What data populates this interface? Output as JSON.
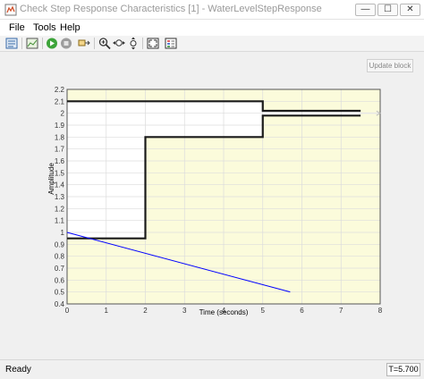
{
  "window": {
    "title": "Check Step Response Characteristics [1] - WaterLevelStepResponse",
    "minimize_glyph": "—",
    "maximize_glyph": "☐",
    "close_glyph": "✕"
  },
  "menu": {
    "items": [
      "File",
      "Tools",
      "Help"
    ]
  },
  "toolbar": {
    "buttons": [
      "block-parameters",
      "save-figure",
      "run-simulation",
      "stop-simulation",
      "highlight-block",
      "zoom-in",
      "zoom-x",
      "zoom-y",
      "fit-to-view",
      "legend"
    ]
  },
  "update_block": {
    "label": "Update block"
  },
  "status": {
    "text": "Ready",
    "time": "T=5.700"
  },
  "chart_data": {
    "type": "line",
    "xlabel": "Time (seconds)",
    "ylabel": "Amplitude",
    "xlim": [
      0,
      8
    ],
    "ylim": [
      0.4,
      2.2
    ],
    "xticks": [
      "0",
      "1",
      "2",
      "3",
      "4",
      "5",
      "6",
      "7",
      "8"
    ],
    "yticks": [
      "0.4",
      "0.5",
      "0.6",
      "0.7",
      "0.8",
      "0.9",
      "1",
      "1.1",
      "1.2",
      "1.3",
      "1.4",
      "1.5",
      "1.6",
      "1.7",
      "1.8",
      "1.9",
      "2",
      "2.1",
      "2.2"
    ],
    "grid": true,
    "colors": {
      "bounds_fill": "#fbfbdb",
      "plot_bg": "#ffffff",
      "bounds_line": "#1a1a1a",
      "signal": "#0000ff"
    },
    "series": [
      {
        "role": "upper-bound",
        "x": [
          0,
          5,
          5,
          7.5
        ],
        "y": [
          2.1,
          2.1,
          2.02,
          2.02
        ]
      },
      {
        "role": "lower-bound",
        "x": [
          0,
          2,
          2,
          5,
          5,
          7.5
        ],
        "y": [
          0.95,
          0.95,
          1.8,
          1.8,
          1.98,
          1.98
        ]
      },
      {
        "role": "response",
        "x": [
          0,
          5.7
        ],
        "y": [
          1.0,
          0.5
        ]
      }
    ],
    "reference_marker": {
      "x": 7.95,
      "y": 2.0
    }
  }
}
